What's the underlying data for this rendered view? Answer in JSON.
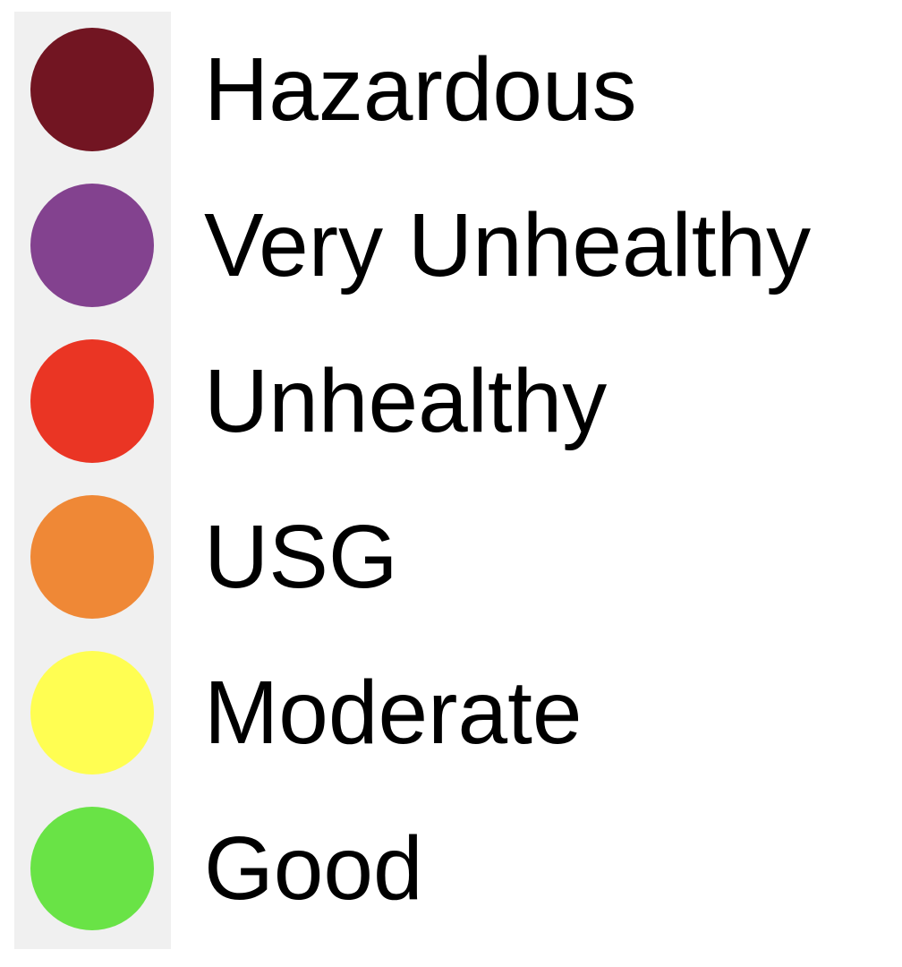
{
  "legend": {
    "items": [
      {
        "label": "Hazardous",
        "color": "#721522"
      },
      {
        "label": "Very Unhealthy",
        "color": "#83428f"
      },
      {
        "label": "Unhealthy",
        "color": "#ea3524"
      },
      {
        "label": "USG",
        "color": "#ef8836"
      },
      {
        "label": "Moderate",
        "color": "#fffe52"
      },
      {
        "label": "Good",
        "color": "#69e346"
      }
    ]
  }
}
